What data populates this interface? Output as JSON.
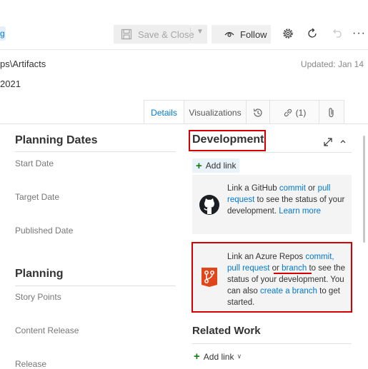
{
  "toolbar": {
    "tag_fragment": "g",
    "save_close_label": "Save & Close",
    "follow_label": "Follow",
    "more_label": "···"
  },
  "header": {
    "area_path": "ps\\Artifacts",
    "iteration": "2021",
    "updated": "Updated: Jan 14"
  },
  "tabs": [
    {
      "label": "Details",
      "active": true
    },
    {
      "label": "Visualizations",
      "active": false
    },
    {
      "label": "",
      "icon": "history-icon"
    },
    {
      "label": "(1)",
      "icon": "link-icon"
    },
    {
      "label": "",
      "icon": "attachment-icon"
    }
  ],
  "left": {
    "planning_dates": {
      "title": "Planning Dates",
      "fields": [
        "Start Date",
        "Target Date",
        "Published Date"
      ]
    },
    "planning": {
      "title": "Planning",
      "fields": [
        "Story Points",
        "Content Release",
        "Release"
      ]
    }
  },
  "development": {
    "title": "Development",
    "add_link_label": "Add link",
    "github_card": {
      "t1": "Link a GitHub ",
      "commit": "commit",
      "t2": " or ",
      "pull_request": "pull request",
      "t3": " to see the status of your development. ",
      "learn_more": "Learn more"
    },
    "azure_card": {
      "t1": "Link an Azure Repos ",
      "commit": "commit,",
      "t2": " ",
      "pull_request": "pull request",
      "t3": " or ",
      "branch": "branch",
      "t4": " to see the status of your development. You can also ",
      "create_branch": "create a branch",
      "t5": " to get started."
    }
  },
  "related_work": {
    "title": "Related Work",
    "add_link_label": "Add link"
  },
  "colors": {
    "accent": "#0078d4",
    "highlight_red": "#d40000",
    "add_green": "#107c10",
    "azure_repos_orange": "#e0461a"
  }
}
